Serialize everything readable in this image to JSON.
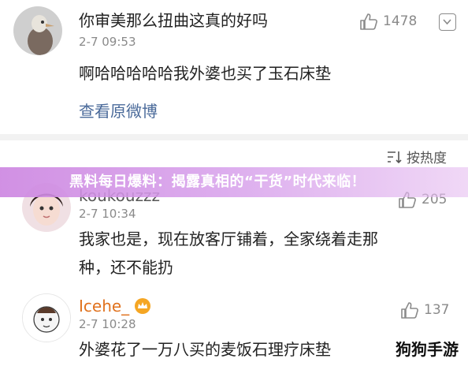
{
  "comments": [
    {
      "nickname": "",
      "title_line": "你审美那么扭曲这真的好吗",
      "time": "2-7 09:53",
      "text": "啊哈哈哈哈哈我外婆也买了玉石床垫",
      "likes": "1478",
      "link": "查看原微博"
    },
    {
      "nickname": "koukouzzz",
      "time": "2-7 10:34",
      "text_line1": "我家也是，现在放客厅铺着，全家绕着走那",
      "text_line2": "种，还不能扔",
      "likes": "205"
    },
    {
      "nickname": "Icehe_",
      "time": "2-7 10:28",
      "text": "外婆花了一万八买的麦饭石理疗床垫",
      "likes": "137"
    }
  ],
  "sort_label": "按热度",
  "banner_text": "黑料每日爆料：揭露真相的“干货”时代来临！",
  "watermark": "狗狗手游",
  "colors": {
    "link": "#4a6a9a",
    "banner": "#d08ae4",
    "muted": "#8a8a8a"
  }
}
